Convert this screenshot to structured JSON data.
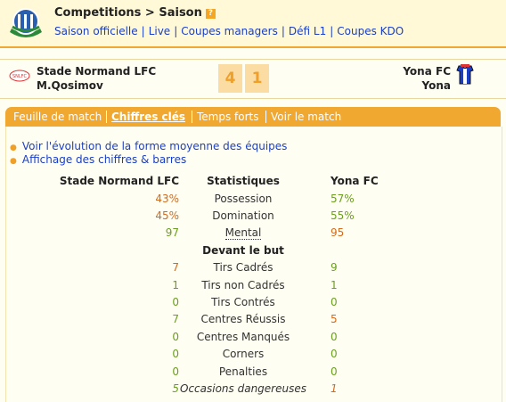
{
  "breadcrumb": "Competitions > Saison",
  "help_glyph": "?",
  "nav": [
    "Saison officielle",
    "Live",
    "Coupes managers",
    "Défi L1",
    "Coupes KDO"
  ],
  "home": {
    "team": "Stade Normand LFC",
    "manager": "M.Qosimov",
    "logo_text": "SNLFC",
    "score": "4"
  },
  "away": {
    "team": "Yona FC",
    "manager": "Yona",
    "score": "1"
  },
  "tabs": [
    "Feuille de match",
    "Chiffres clés",
    "Temps forts",
    "Voir le match"
  ],
  "active_tab": "Chiffres clés",
  "links": [
    "Voir l'évolution de la forme moyenne des équipes",
    "Affichage des chiffres & barres"
  ],
  "headers": {
    "home": "Stade Normand LFC",
    "stat": "Statistiques",
    "away": "Yona FC"
  },
  "stats": [
    {
      "label": "Possession",
      "home": "43%",
      "away": "57%"
    },
    {
      "label": "Domination",
      "home": "45%",
      "away": "55%"
    },
    {
      "label": "Mental",
      "home": "97",
      "away": "95"
    }
  ],
  "section": "Devant le but",
  "goal_stats": [
    {
      "label": "Tirs Cadrés",
      "home": "7",
      "away": "9"
    },
    {
      "label": "Tirs non Cadrés",
      "home": "1",
      "away": "1"
    },
    {
      "label": "Tirs Contrés",
      "home": "0",
      "away": "0"
    },
    {
      "label": "Centres Réussis",
      "home": "7",
      "away": "5"
    },
    {
      "label": "Centres Manqués",
      "home": "0",
      "away": "0"
    },
    {
      "label": "Corners",
      "home": "0",
      "away": "0"
    },
    {
      "label": "Penalties",
      "home": "0",
      "away": "0"
    },
    {
      "label": "Occasions dangereuses",
      "home": "5",
      "away": "1"
    }
  ],
  "colors": {
    "accent": "#f0a830",
    "link": "#1a3fc4",
    "win": "#6b9e1f",
    "lose": "#d46a1a"
  }
}
